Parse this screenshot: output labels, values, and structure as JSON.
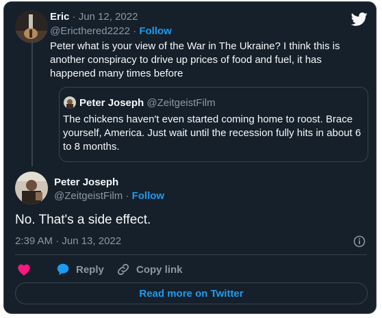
{
  "reply": {
    "name": "Eric",
    "separator": " · ",
    "date": "Jun 12, 2022",
    "handle": "@Ericthered2222",
    "dot": " · ",
    "follow": "Follow",
    "text": "Peter what is your view of the War in The Ukraine? I think this is another conspiracy to drive up prices of food and fuel, it has happened many times before"
  },
  "quote": {
    "name": "Peter Joseph",
    "handle": "@ZeitgeistFilm",
    "text": "The chickens haven't even started coming home to roost. Brace yourself, America. Just wait until the recession fully hits in about 6 to 8 months."
  },
  "main": {
    "name": "Peter Joseph",
    "handle": "@ZeitgeistFilm",
    "dot": " · ",
    "follow": "Follow",
    "text": "No. That's a side effect.",
    "timestamp": "2:39 AM · Jun 13, 2022"
  },
  "actions": {
    "reply": "Reply",
    "copy_link": "Copy link"
  },
  "footer": {
    "read_more": "Read more on Twitter"
  },
  "colors": {
    "background": "#15202b",
    "accent": "#1d9bf0",
    "like": "#f91880",
    "muted": "#8b98a5"
  },
  "icons": [
    "twitter-logo-icon",
    "heart-icon",
    "reply-bubble-icon",
    "link-icon",
    "info-icon"
  ]
}
